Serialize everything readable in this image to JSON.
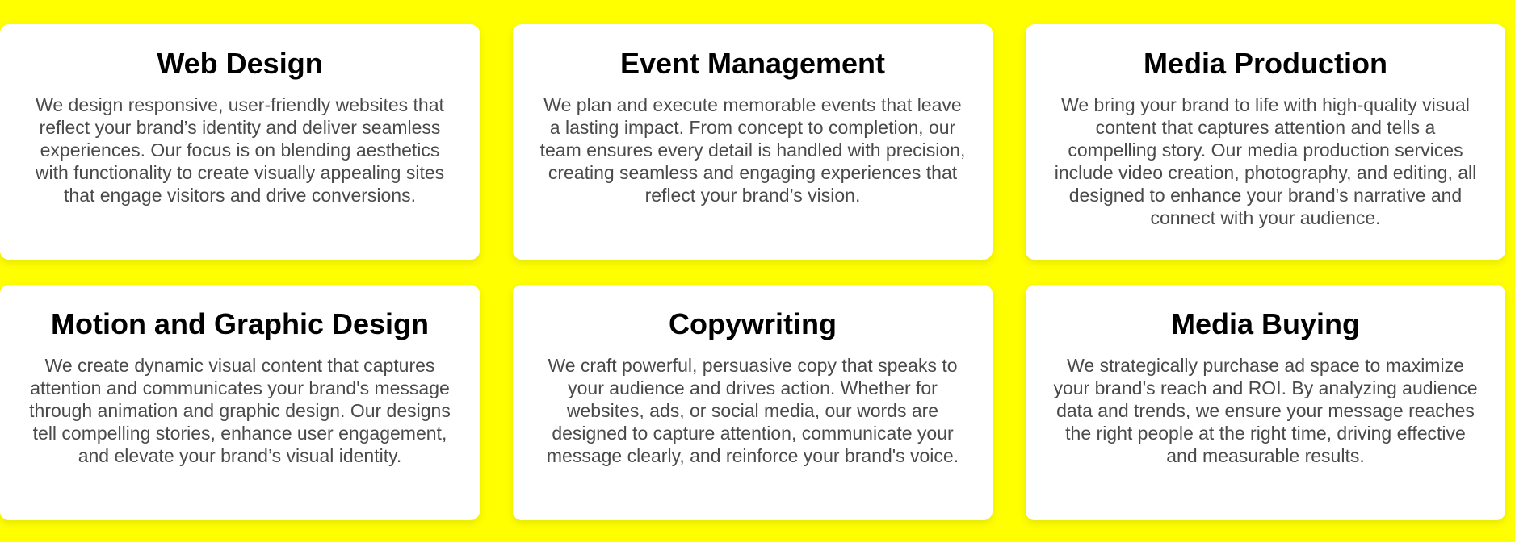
{
  "colors": {
    "page_background": "#ffff00",
    "card_background": "#ffffff",
    "title_text": "#000000",
    "body_text": "#4a4a4a"
  },
  "services": [
    {
      "title": "Web Design",
      "description": "We design responsive, user-friendly websites that reflect your brand’s identity and deliver seamless experiences. Our focus is on blending aesthetics with functionality to create visually appealing sites that engage visitors and drive conversions."
    },
    {
      "title": "Event Management",
      "description": "We plan and execute memorable events that leave a lasting impact. From concept to completion, our team ensures every detail is handled with precision, creating seamless and engaging experiences that reflect your brand’s vision."
    },
    {
      "title": "Media Production",
      "description": "We bring your brand to life with high-quality visual content that captures attention and tells a compelling story. Our media production services include video creation, photography, and editing, all designed to enhance your brand's narrative and connect with your audience."
    },
    {
      "title": "Motion and Graphic Design",
      "description": "We create dynamic visual content that captures attention and communicates your brand's message through animation and graphic design. Our designs tell compelling stories, enhance user engagement, and elevate your brand’s visual identity."
    },
    {
      "title": "Copywriting",
      "description": "We craft powerful, persuasive copy that speaks to your audience and drives action. Whether for websites, ads, or social media, our words are designed to capture attention, communicate your message clearly, and reinforce your brand's voice."
    },
    {
      "title": "Media Buying",
      "description": "We strategically purchase ad space to maximize your brand’s reach and ROI. By analyzing audience data and trends, we ensure your message reaches the right people at the right time, driving effective and measurable results."
    }
  ]
}
